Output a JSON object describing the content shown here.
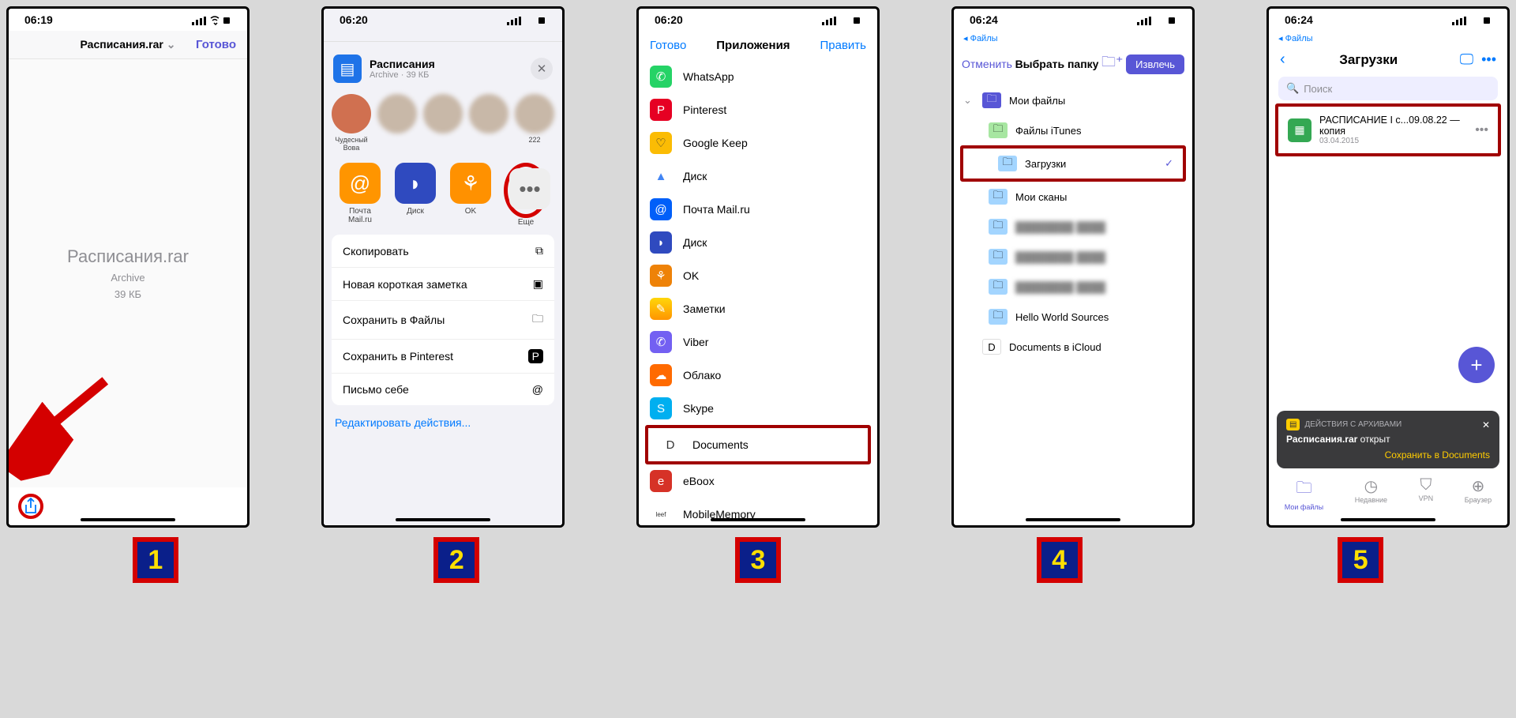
{
  "s1": {
    "time": "06:19",
    "title": "Расписания.rar",
    "done": "Готово",
    "filename": "Расписания.rar",
    "type": "Archive",
    "size": "39 КБ"
  },
  "s2": {
    "time": "06:20",
    "sheet_title": "Расписания",
    "sheet_sub": "Archive · 39 КБ",
    "contact1": "Чудесный Вова",
    "contact2_num": "222",
    "app1": "Почта Mail.ru",
    "app2": "Диск",
    "app3": "OK",
    "app4": "Еще",
    "act1": "Скопировать",
    "act2": "Новая короткая заметка",
    "act3": "Сохранить в Файлы",
    "act4": "Сохранить в Pinterest",
    "act5": "Письмо себе",
    "edit": "Редактировать действия..."
  },
  "s3": {
    "time": "06:20",
    "done": "Готово",
    "title": "Приложения",
    "edit": "Править",
    "apps": [
      "WhatsApp",
      "Pinterest",
      "Google Keep",
      "Диск",
      "Почта Mail.ru",
      "Диск",
      "OK",
      "Заметки",
      "Viber",
      "Облако",
      "Skype",
      "Documents",
      "eBoox",
      "MobileMemory"
    ]
  },
  "s4": {
    "time": "06:24",
    "mini": "Файлы",
    "cancel": "Отменить",
    "title": "Выбрать папку",
    "extract": "Извлечь",
    "root": "Мои файлы",
    "f1": "Файлы iTunes",
    "f2": "Загрузки",
    "f3": "Мои сканы",
    "f4": "Hello World Sources",
    "icloud": "Documents в iCloud"
  },
  "s5": {
    "time": "06:24",
    "mini": "Файлы",
    "title": "Загрузки",
    "search": "Поиск",
    "file": "РАСПИСАНИЕ I с...09.08.22 — копия",
    "date": "03.04.2015",
    "toast_cat": "ДЕЙСТВИЯ С АРХИВАМИ",
    "toast_line": "Расписания.rar открыт",
    "toast_name": "Расписания.rar",
    "toast_save": "Сохранить в Documents",
    "tab1": "Мои файлы",
    "tab2": "Недавние",
    "tab3": "VPN",
    "tab4": "Браузер"
  },
  "nums": [
    "1",
    "2",
    "3",
    "4",
    "5"
  ]
}
